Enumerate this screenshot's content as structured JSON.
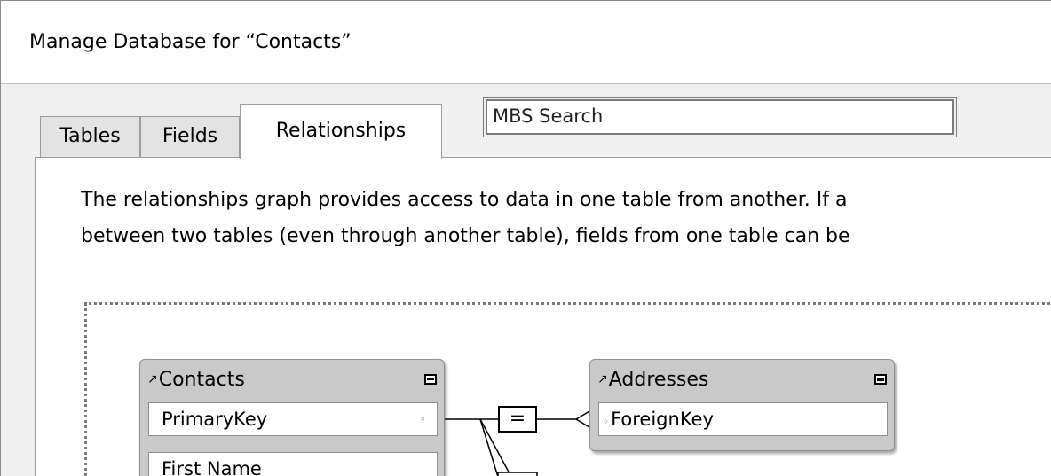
{
  "window": {
    "title": "Manage Database for “Contacts”"
  },
  "tabs": [
    {
      "label": "Tables",
      "selected": false
    },
    {
      "label": "Fields",
      "selected": false
    },
    {
      "label": "Relationships",
      "selected": true
    }
  ],
  "search": {
    "value": "MBS Search"
  },
  "description": {
    "line1": "The relationships graph provides access to data in one table from another. If a",
    "line2": "between two tables (even through another table), fields from one table can be"
  },
  "graph": {
    "tables": [
      {
        "name": "Contacts",
        "fields": [
          "PrimaryKey",
          "First Name"
        ]
      },
      {
        "name": "Addresses",
        "fields": [
          "ForeignKey"
        ]
      }
    ],
    "relationship": {
      "operator": "=",
      "left_field": "PrimaryKey",
      "right_field": "ForeignKey"
    }
  },
  "colors": {
    "dialog_bg": "#f0f0f0",
    "panel_bg": "#ffffff",
    "table_header_bg": "#c9c9c9",
    "border": "#9c9c9c"
  }
}
